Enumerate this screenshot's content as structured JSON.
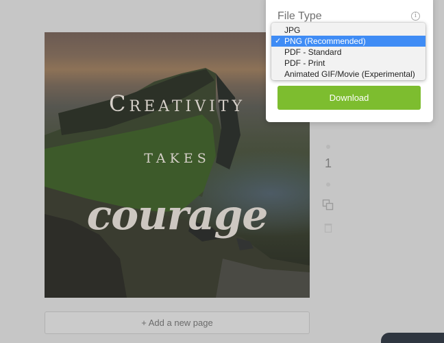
{
  "design": {
    "line1": "Creativity",
    "line2": "takes",
    "line3": "courage"
  },
  "add_page": {
    "label": "+ Add a new page"
  },
  "sidebar": {
    "page_number": "1"
  },
  "download_panel": {
    "label": "File Type",
    "download_label": "Download",
    "options": [
      {
        "label": "JPG",
        "selected": false
      },
      {
        "label": "PNG (Recommended)",
        "selected": true
      },
      {
        "label": "PDF - Standard",
        "selected": false
      },
      {
        "label": "PDF - Print",
        "selected": false
      },
      {
        "label": "Animated GIF/Movie (Experimental)",
        "selected": false
      }
    ]
  },
  "icons": {
    "info": "info-icon",
    "check": "check-icon",
    "copy": "copy-page-icon",
    "delete": "trash-icon"
  },
  "colors": {
    "accent": "#7dbd2f",
    "selection": "#3f8cf5",
    "backdrop": "#c6c6c6"
  }
}
